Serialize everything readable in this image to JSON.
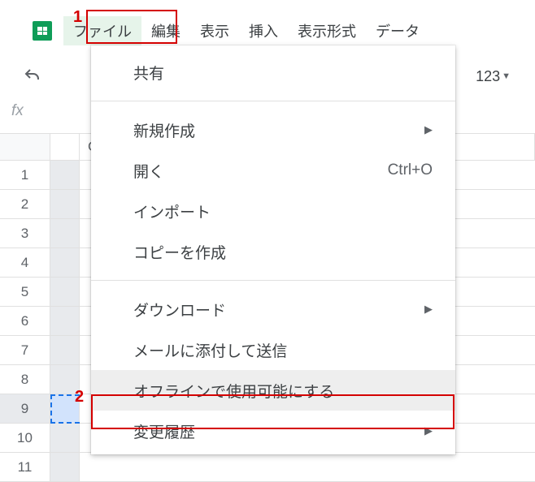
{
  "menubar": {
    "items": [
      {
        "label": "ファイル",
        "active": true
      },
      {
        "label": "編集"
      },
      {
        "label": "表示"
      },
      {
        "label": "挿入"
      },
      {
        "label": "表示形式"
      },
      {
        "label": "データ"
      }
    ]
  },
  "toolbar": {
    "number_format_label": "123"
  },
  "fx_label": "fx",
  "columns": {
    "a": "",
    "c": "C"
  },
  "rows": [
    "1",
    "2",
    "3",
    "4",
    "5",
    "6",
    "7",
    "8",
    "9",
    "10",
    "11"
  ],
  "selected_row_index": 8,
  "dropdown": {
    "items": [
      {
        "label": "共有"
      },
      {
        "sep": true
      },
      {
        "label": "新規作成",
        "submenu": true
      },
      {
        "label": "開く",
        "shortcut": "Ctrl+O"
      },
      {
        "label": "インポート"
      },
      {
        "label": "コピーを作成"
      },
      {
        "sep": true
      },
      {
        "label": "ダウンロード",
        "submenu": true
      },
      {
        "label": "メールに添付して送信"
      },
      {
        "label": "オフラインで使用可能にする",
        "highlight": true
      },
      {
        "label": "変更履歴",
        "submenu": true
      }
    ]
  },
  "annotations": {
    "n1": "1",
    "n2": "2"
  }
}
